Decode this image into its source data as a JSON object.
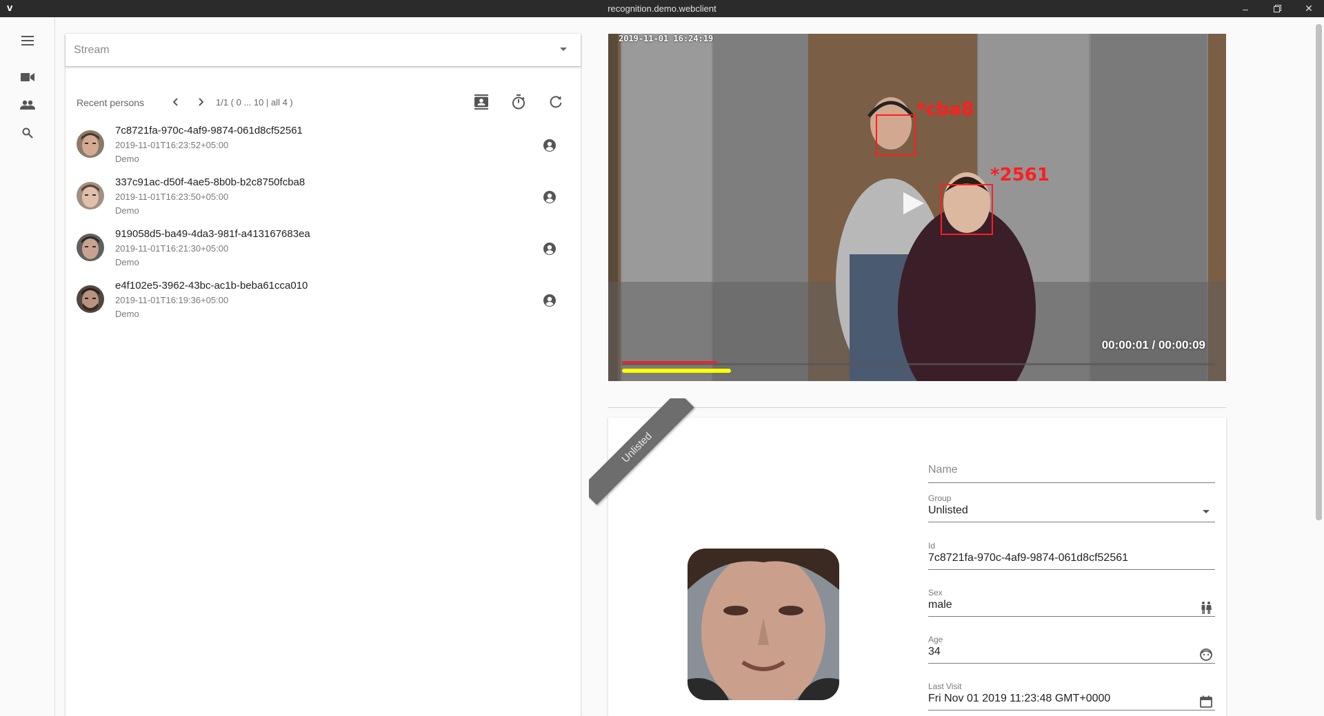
{
  "window": {
    "title": "recognition.demo.webclient",
    "logo_text": "v",
    "controls": [
      "minimize-icon",
      "restore-icon",
      "close-icon"
    ]
  },
  "rail": {
    "items": [
      {
        "name": "menu-icon"
      },
      {
        "name": "videocam-icon"
      },
      {
        "name": "people-icon"
      },
      {
        "name": "search-icon"
      }
    ]
  },
  "stream": {
    "label": "Stream"
  },
  "recent": {
    "label": "Recent persons",
    "pager": "1/1 ( 0 ... 10 | all 4 )"
  },
  "persons": [
    {
      "id": "7c8721fa-970c-4af9-9874-061d8cf52561",
      "time": "2019-11-01T16:23:52+05:00",
      "group": "Demo"
    },
    {
      "id": "337c91ac-d50f-4ae5-8b0b-b2c8750fcba8",
      "time": "2019-11-01T16:23:50+05:00",
      "group": "Demo"
    },
    {
      "id": "919058d5-ba49-4da3-981f-a413167683ea",
      "time": "2019-11-01T16:21:30+05:00",
      "group": "Demo"
    },
    {
      "id": "e4f102e5-3962-43bc-ac1b-beba61cca010",
      "time": "2019-11-01T16:19:36+05:00",
      "group": "Demo"
    }
  ],
  "video": {
    "timestamp": "2019-11-01 16:24:19",
    "tag_a": "*cba8",
    "tag_b": "*2561",
    "playback_time": "00:00:01 / 00:00:09",
    "progress": 0.16,
    "buffered": 0.18
  },
  "detail": {
    "ribbon": "Unlisted",
    "name_placeholder": "Name",
    "group_label": "Group",
    "group_value": "Unlisted",
    "id_label": "Id",
    "id_value": "7c8721fa-970c-4af9-9874-061d8cf52561",
    "sex_label": "Sex",
    "sex_value": "male",
    "age_label": "Age",
    "age_value": "34",
    "last_visit_label": "Last Visit",
    "last_visit_value": "Fri Nov 01 2019 11:23:48 GMT+0000"
  },
  "colors": {
    "accent_red": "#ff1e1e",
    "progress_yellow": "#ffff00",
    "progress_red": "#d32f2f"
  }
}
